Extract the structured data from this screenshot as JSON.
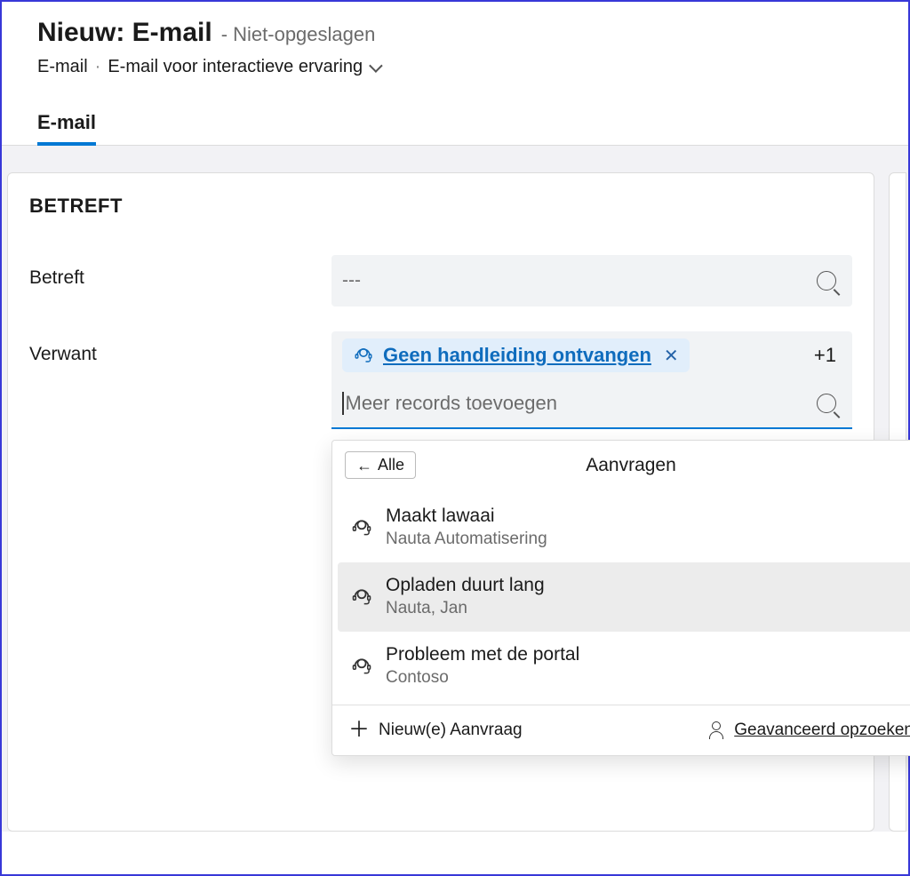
{
  "header": {
    "title_main": "Nieuw: E-mail",
    "title_status": "- Niet-opgeslagen",
    "entity_label": "E-mail",
    "form_selector": "E-mail voor interactieve ervaring"
  },
  "tabs": {
    "active": "E-mail"
  },
  "section": {
    "title": "BETREFT",
    "fields": {
      "betreft": {
        "label": "Betreft",
        "placeholder": "---"
      },
      "verwant": {
        "label": "Verwant",
        "selected_pill": "Geen handleiding ontvangen",
        "extra_count": "+1",
        "add_more_placeholder": "Meer records toevoegen"
      }
    }
  },
  "dropdown": {
    "back_label": "Alle",
    "title": "Aanvragen",
    "items": [
      {
        "title": "Maakt lawaai",
        "subtitle": "Nauta Automatisering"
      },
      {
        "title": "Opladen duurt lang",
        "subtitle": "Nauta, Jan"
      },
      {
        "title": "Probleem met de portal",
        "subtitle": "Contoso"
      }
    ],
    "footer": {
      "new_label": "Nieuw(e) Aanvraag",
      "advanced_label": "Geavanceerd opzoeken"
    }
  }
}
